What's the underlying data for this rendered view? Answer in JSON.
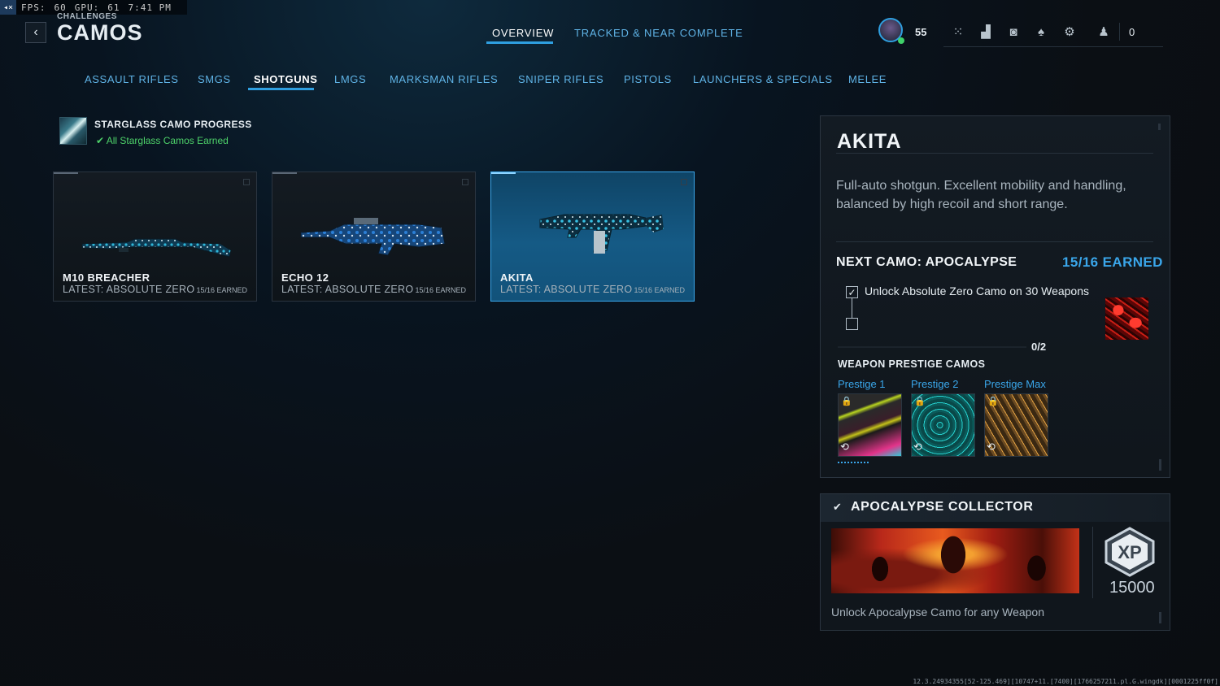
{
  "overlay": {
    "fps_label": "FPS:",
    "fps_value": "60",
    "gpu_label": "GPU:",
    "gpu_value": "61",
    "time": "7:41 PM"
  },
  "header": {
    "breadcrumb": "CHALLENGES",
    "title": "CAMOS",
    "tabs": [
      {
        "label": "OVERVIEW",
        "active": true
      },
      {
        "label": "TRACKED & NEAR COMPLETE",
        "active": false
      }
    ],
    "player_level": "55",
    "party_count": "0"
  },
  "categories": [
    {
      "label": "ASSAULT RIFLES"
    },
    {
      "label": "SMGS"
    },
    {
      "label": "SHOTGUNS",
      "active": true
    },
    {
      "label": "LMGS"
    },
    {
      "label": "MARKSMAN RIFLES"
    },
    {
      "label": "SNIPER RIFLES"
    },
    {
      "label": "PISTOLS"
    },
    {
      "label": "LAUNCHERS & SPECIALS"
    },
    {
      "label": "MELEE"
    }
  ],
  "starglass": {
    "title": "STARGLASS CAMO PROGRESS",
    "status": "All Starglass Camos Earned",
    "status_color": "#4ed36a"
  },
  "weapons": [
    {
      "name": "M10 BREACHER",
      "latest": "LATEST: ABSOLUTE ZERO",
      "earned": "15/16 EARNED",
      "selected": false
    },
    {
      "name": "ECHO 12",
      "latest": "LATEST: ABSOLUTE ZERO",
      "earned": "15/16 EARNED",
      "selected": false
    },
    {
      "name": "AKITA",
      "latest": "LATEST: ABSOLUTE ZERO",
      "earned": "15/16 EARNED",
      "selected": true
    }
  ],
  "detail": {
    "name": "AKITA",
    "description": "Full-auto shotgun. Excellent mobility and handling, balanced by high recoil and short range.",
    "next_camo": "NEXT CAMO: APOCALYPSE",
    "earned": "15/16 EARNED",
    "requirement": "Unlock Absolute Zero Camo on 30 Weapons",
    "requirement_done": true,
    "progress": "0/2",
    "progress_fraction": 0,
    "prestige_title": "WEAPON PRESTIGE CAMOS",
    "prestige": [
      {
        "label": "Prestige 1",
        "locked": true
      },
      {
        "label": "Prestige 2",
        "locked": true
      },
      {
        "label": "Prestige Max",
        "locked": true
      }
    ]
  },
  "collector": {
    "title": "APOCALYPSE COLLECTOR",
    "xp_label": "XP",
    "xp_value": "15000",
    "description": "Unlock Apocalypse Camo for any Weapon"
  },
  "build_string": "12.3.24934355[52-125.469][10747+11.[7400][1766257211.pl.G.wingdk][0001225ff0f]",
  "colors": {
    "accent": "#2f9fe0",
    "accent_text": "#3aa6ea",
    "success": "#4ed36a"
  }
}
